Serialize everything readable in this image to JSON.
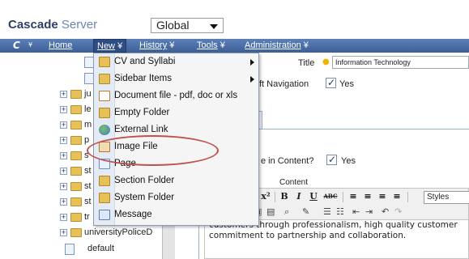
{
  "header": {
    "brand_part1": "Cascade",
    "brand_part2": "Server",
    "site_select_value": "Global"
  },
  "nav": {
    "logo": "C",
    "items": [
      {
        "label": "Home"
      },
      {
        "label": "New"
      },
      {
        "label": "History"
      },
      {
        "label": "Tools"
      },
      {
        "label": "Administration"
      }
    ],
    "arrow": "¥"
  },
  "new_menu": {
    "items": [
      {
        "label": "CV and Syllabi",
        "icon": "folder-icon",
        "has_submenu": true
      },
      {
        "label": "Sidebar Items",
        "icon": "folder-icon",
        "has_submenu": true
      },
      {
        "label": "Document file - pdf, doc or xls",
        "icon": "document-icon",
        "has_submenu": false
      },
      {
        "label": "Empty Folder",
        "icon": "folder-icon",
        "has_submenu": false
      },
      {
        "label": "External Link",
        "icon": "globe-link-icon",
        "has_submenu": false
      },
      {
        "label": "Image File",
        "icon": "image-file-icon",
        "has_submenu": false
      },
      {
        "label": "Page",
        "icon": "page-icon",
        "has_submenu": false
      },
      {
        "label": "Section Folder",
        "icon": "folder-icon",
        "has_submenu": false
      },
      {
        "label": "System Folder",
        "icon": "folder-icon",
        "has_submenu": false
      },
      {
        "label": "Message",
        "icon": "message-icon",
        "has_submenu": false
      }
    ],
    "highlighted_item": "Image File"
  },
  "tree": {
    "rows": [
      {
        "label": "ju"
      },
      {
        "label": "le"
      },
      {
        "label": "m"
      },
      {
        "label": "p"
      },
      {
        "label": "s"
      },
      {
        "label": "st"
      },
      {
        "label": "st"
      },
      {
        "label": "st"
      },
      {
        "label": "tr"
      },
      {
        "label": "universityPoliceD"
      }
    ],
    "default_label": "default"
  },
  "form": {
    "title_label": "Title",
    "title_value": "Information Technology",
    "left_nav_label": "ft Navigation",
    "yes1": "Yes",
    "section_tab": "ntent",
    "in_content_label": "e in Content?",
    "yes2": "Yes",
    "content_label": "Content",
    "styles_label": "Styles",
    "editor_line1": "customers through professionalism, high quality customer",
    "editor_line2": "commitment to partnership and collaboration."
  },
  "toolbar": {
    "buttons": [
      "x²",
      "B",
      "I",
      "U",
      "ABC"
    ]
  },
  "colors": {
    "nav_bg": "#4a6da8",
    "brand_dark": "#2d3f66",
    "brand_light": "#6a86b8",
    "highlight_ring": "#c0504d"
  }
}
